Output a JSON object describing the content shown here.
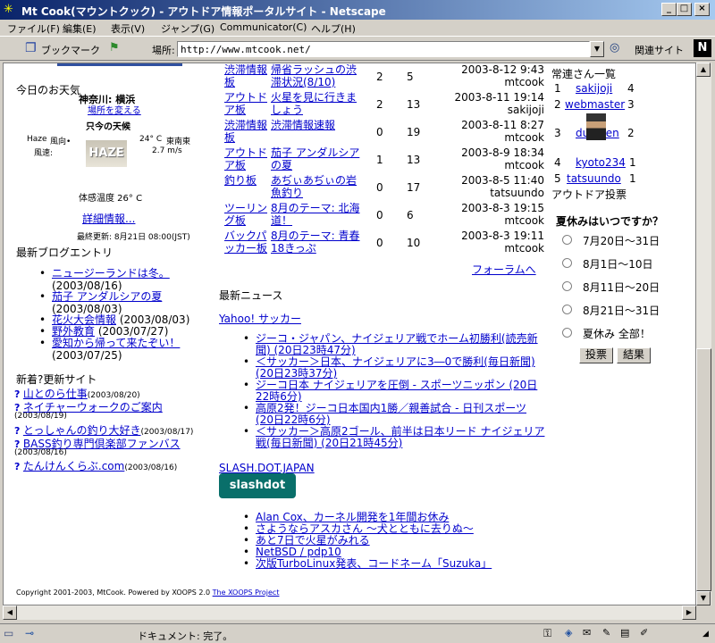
{
  "window": {
    "title": "Mt Cook(マウントクック) - アウトドア情報ポータルサイト - Netscape",
    "min": "_",
    "max": "□",
    "close": "×"
  },
  "menu": [
    "ファイル(F)",
    "編集(E)",
    "表示(V)",
    "ジャンプ(G)",
    "Communicator(C)",
    "ヘルプ(H)"
  ],
  "toolbar": {
    "bookmarks": "ブックマーク",
    "location_label": "場所:",
    "url": "http://www.mtcook.net/",
    "related": "関連サイト"
  },
  "weather": {
    "heading": "今日のお天気",
    "place": "神奈川: 横浜",
    "change_place": "場所を変える",
    "now": "只今の天候",
    "condition": "Haze",
    "wind_dir_label": "風向•",
    "wind_speed_label": "風速:",
    "temp": "24° C",
    "wind_dir": "東南東",
    "wind_speed": "2.7 m/s",
    "haze": "HAZE",
    "feels": "体感温度 26° C",
    "details": "詳細情報...",
    "updated": "最終更新: 8月21日 08:00(JST)"
  },
  "blog": {
    "heading": "最新ブログエントリ",
    "items": [
      {
        "t": "ニュージーランドは冬。",
        "d": "(2003/08/16)"
      },
      {
        "t": "茄子 アンダルシアの夏",
        "d": "(2003/08/03)"
      },
      {
        "t": "花火大会情報",
        "d": "(2003/08/03)"
      },
      {
        "t": "野外教育",
        "d": "(2003/07/27)"
      },
      {
        "t": "愛知から帰って来たぞい！",
        "d": "(2003/07/25)"
      }
    ]
  },
  "sites": {
    "heading": "新着?更新サイト",
    "items": [
      {
        "t": "山とのら仕事",
        "d": "(2003/08/20)"
      },
      {
        "t": "ネイチャーウォークのご案内",
        "d": "(2003/08/19)"
      },
      {
        "t": "とっしゃんの釣り大好き",
        "d": "(2003/08/17)"
      },
      {
        "t": "BASS釣り専門倶楽部ファンバス",
        "d": "(2003/08/16)"
      },
      {
        "t": "たんけんくらぶ.com",
        "d": "(2003/08/16)"
      }
    ]
  },
  "forum": {
    "rows": [
      {
        "cat": "渋滞情報板",
        "title": "帰省ラッシュの渋滞状況(8/10)",
        "a": "2",
        "b": "5",
        "date": "2003-8-12 9:43",
        "user": "mtcook"
      },
      {
        "cat": "アウトドア板",
        "title": "火星を見に行きましょう",
        "a": "2",
        "b": "13",
        "date": "2003-8-11 19:14",
        "user": "sakijoji"
      },
      {
        "cat": "渋滞情報板",
        "title": "渋滞情報速報",
        "a": "0",
        "b": "19",
        "date": "2003-8-11 8:27",
        "user": "mtcook"
      },
      {
        "cat": "アウトドア板",
        "title": "茄子 アンダルシアの夏",
        "a": "1",
        "b": "13",
        "date": "2003-8-9 18:34",
        "user": "mtcook"
      },
      {
        "cat": "釣り板",
        "title": "あぢぃあぢぃの岩魚釣り",
        "a": "0",
        "b": "17",
        "date": "2003-8-5 11:40",
        "user": "tatsuundo"
      },
      {
        "cat": "ツーリング板",
        "title": "8月のテーマ: 北海道！",
        "a": "0",
        "b": "6",
        "date": "2003-8-3 19:15",
        "user": "mtcook"
      },
      {
        "cat": "バックパッカー板",
        "title": "8月のテーマ: 青春18きっぷ",
        "a": "0",
        "b": "10",
        "date": "2003-8-3 19:11",
        "user": "mtcook"
      }
    ],
    "more": "フォーラムへ"
  },
  "news": {
    "heading": "最新ニュース",
    "yahoo": "Yahoo! サッカー",
    "yahoo_items": [
      "ジーコ・ジャパン、ナイジェリア戦でホーム初勝利(読売新聞) (20日23時47分)",
      "＜サッカー＞日本、ナイジェリアに3―0で勝利(毎日新聞) (20日23時37分)",
      "ジーコ日本 ナイジェリアを圧倒 - スポーツニッポン (20日22時6分)",
      "高原2発！ジーコ日本国内1勝／親善試合 - 日刊スポーツ (20日22時6分)",
      "＜サッカー＞高原2ゴール、前半は日本リード ナイジェリア戦(毎日新聞) (20日21時45分)"
    ],
    "slash": "SLASH.DOT.JAPAN",
    "slash_logo": "slashdot",
    "slash_items": [
      "Alan Cox、カーネル開発を1年間お休み",
      "さようならアスカさん 〜犬とともに去りぬ〜",
      "あと7日で火星がみれる",
      "NetBSD / pdp10",
      "次版TurboLinux発表、コードネーム「Suzuka」"
    ]
  },
  "regulars": {
    "heading": "常連さん一覧",
    "rows": [
      {
        "n": "1",
        "u": "sakijoji",
        "c": "4"
      },
      {
        "n": "2",
        "u": "webmaster",
        "c": "3"
      },
      {
        "n": "3",
        "u": "duniden",
        "c": "2"
      },
      {
        "n": "4",
        "u": "kyoto234",
        "c": "1"
      },
      {
        "n": "5",
        "u": "tatsuundo",
        "c": "1"
      }
    ]
  },
  "poll": {
    "heading": "アウトドア投票",
    "question": "夏休みはいつですか？",
    "options": [
      "7月20日〜31日",
      "8月1日〜10日",
      "8月11日〜20日",
      "8月21日〜31日",
      "夏休み 全部！"
    ],
    "vote": "投票",
    "results": "結果"
  },
  "footer": {
    "copyright": "Copyright 2001-2003, MtCook. Powered by XOOPS 2.0",
    "xoops": "The XOOPS Project"
  },
  "status": {
    "text": "ドキュメント: 完了。"
  }
}
